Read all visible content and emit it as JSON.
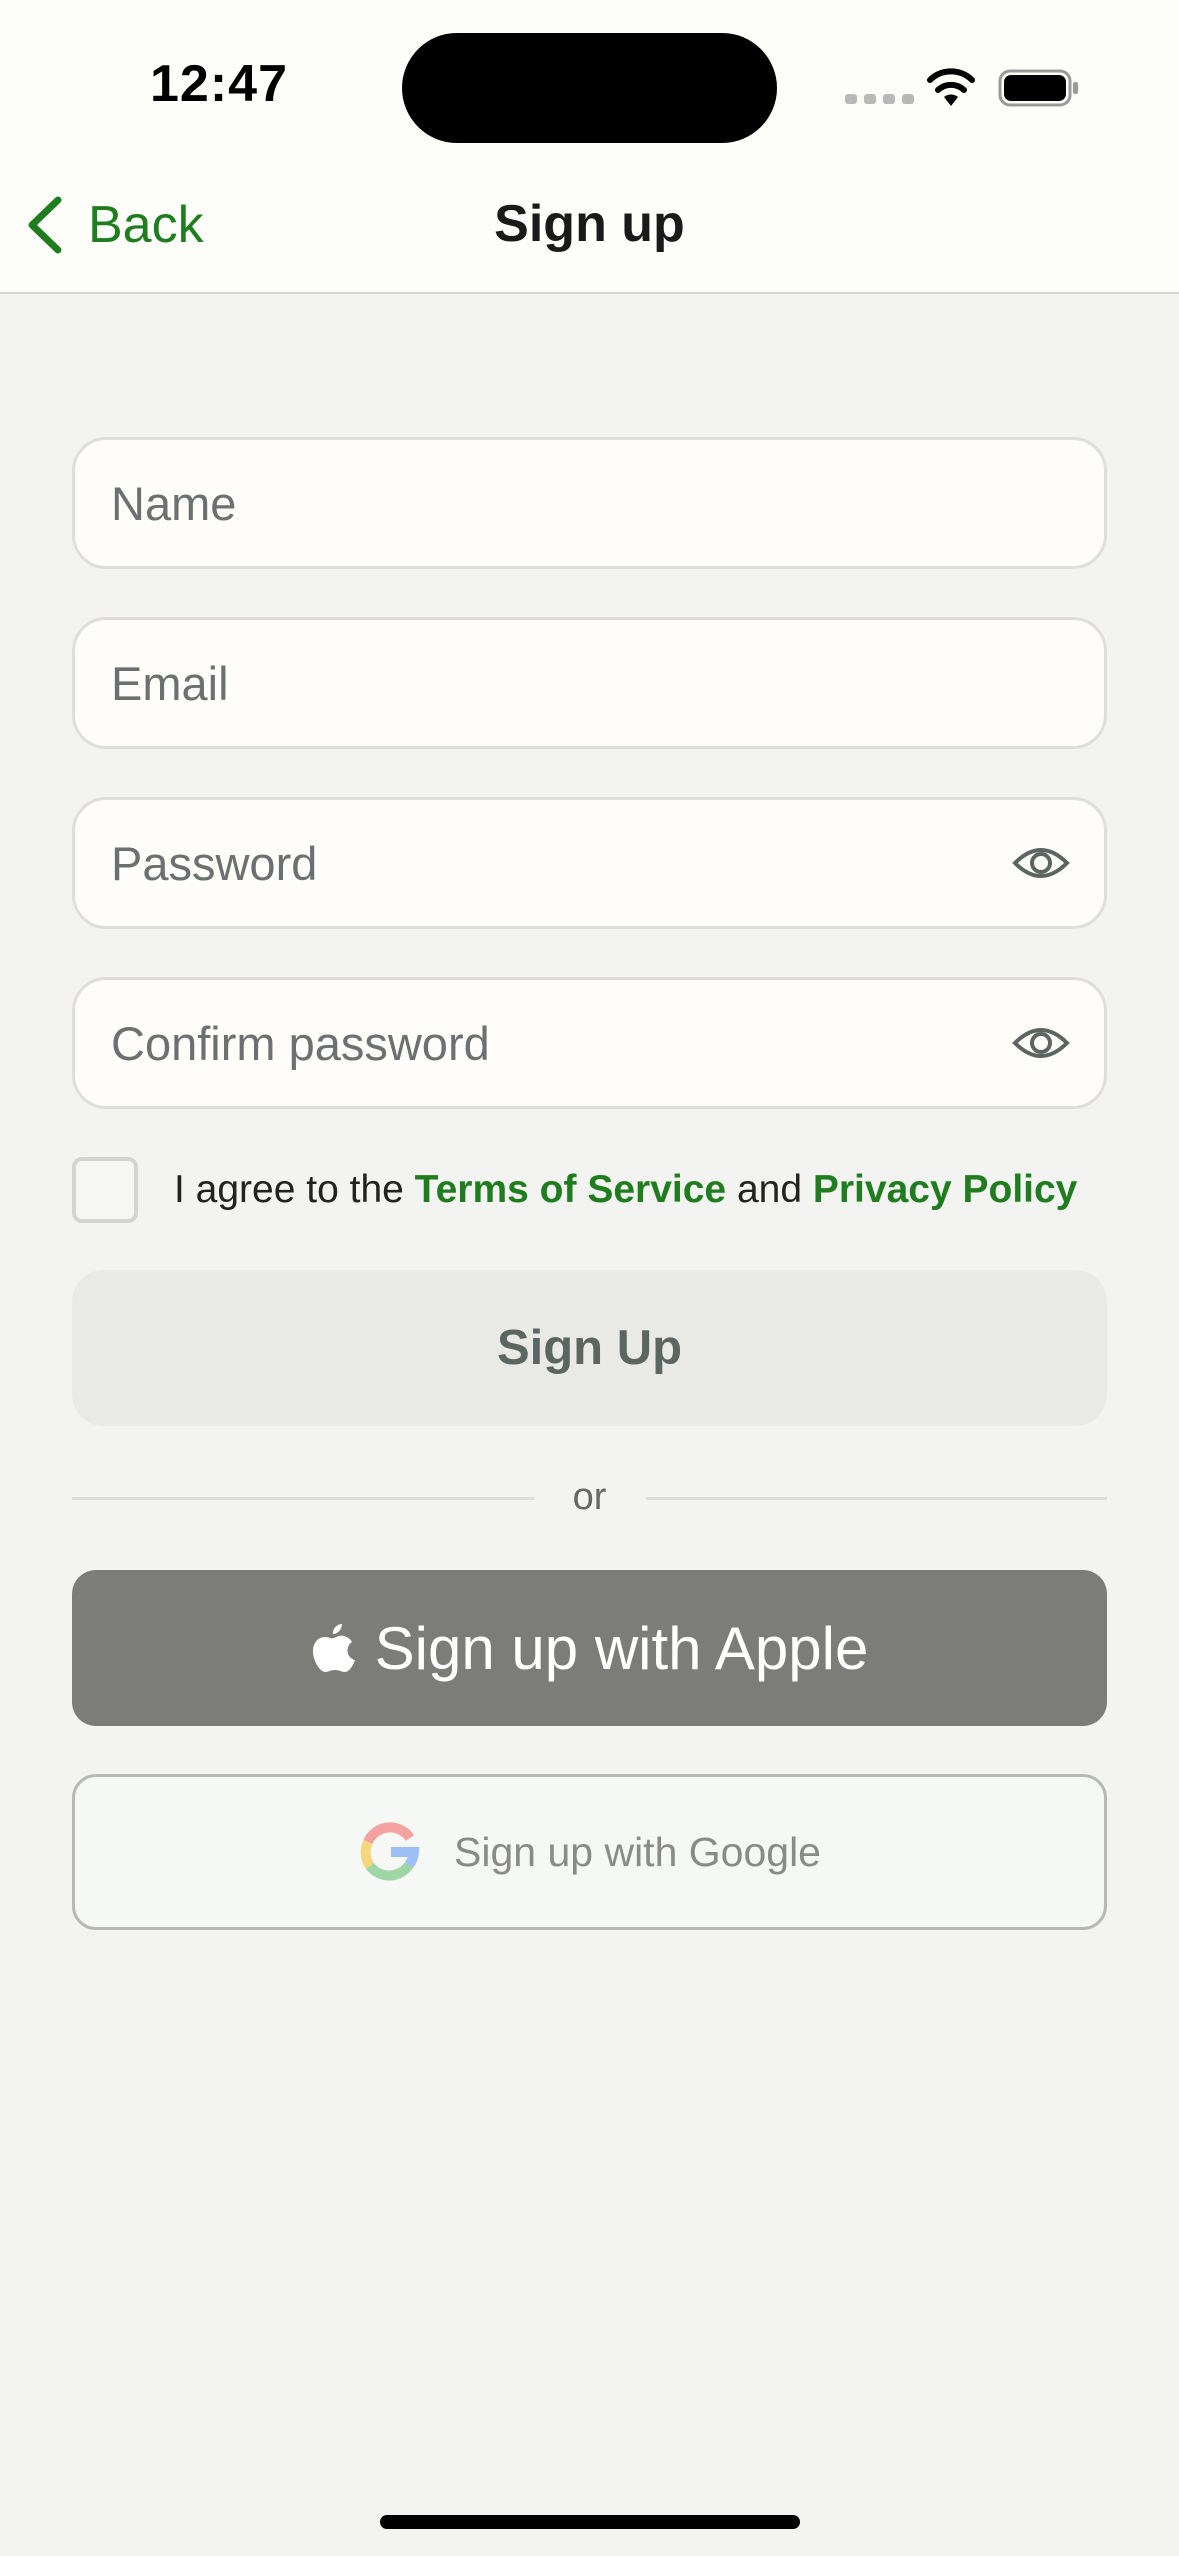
{
  "status_bar": {
    "time": "12:47"
  },
  "nav": {
    "back_label": "Back",
    "title": "Sign up"
  },
  "form": {
    "name_placeholder": "Name",
    "email_placeholder": "Email",
    "password_placeholder": "Password",
    "confirm_placeholder": "Confirm password"
  },
  "terms": {
    "prefix": "I agree to the ",
    "tos": "Terms of Service",
    "and": " and ",
    "privacy": "Privacy Policy",
    "checked": false
  },
  "buttons": {
    "sign_up": "Sign Up",
    "divider": "or",
    "apple": "Sign up with Apple",
    "google": "Sign up with Google"
  },
  "icons": {
    "back": "chevron-left-icon",
    "password_toggle": "eye-icon",
    "apple": "apple-logo-icon",
    "google": "google-logo-icon",
    "wifi": "wifi-icon",
    "battery": "battery-icon"
  },
  "colors": {
    "accent": "#1f7d1f",
    "apple_button": "#7c7c78",
    "background": "#f3f3f1"
  }
}
